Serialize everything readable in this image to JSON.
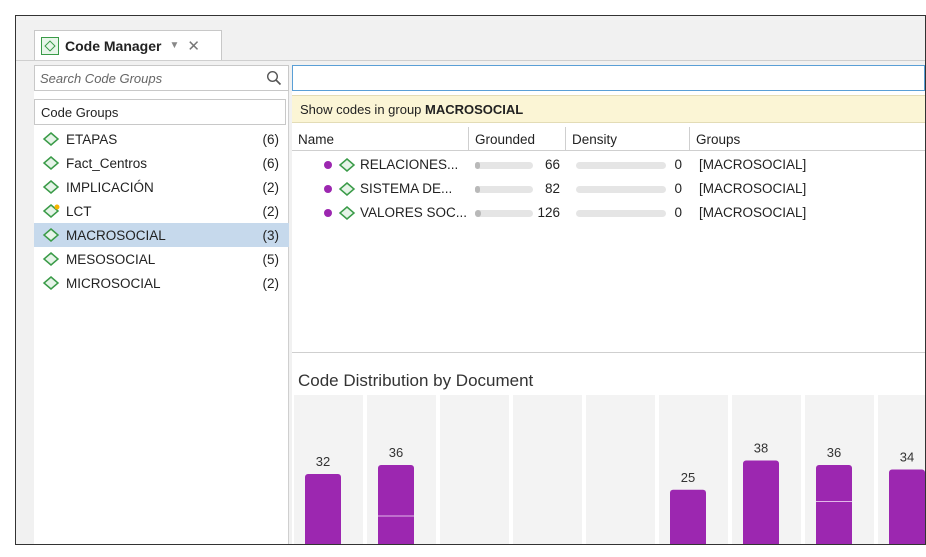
{
  "tab": {
    "title": "Code Manager",
    "dropdown": "▼",
    "close": "✕"
  },
  "search": {
    "placeholder": "Search Code Groups"
  },
  "groups_header": "Code Groups",
  "groups": [
    {
      "label": "ETAPAS",
      "count": "(6)",
      "selected": false,
      "star": false
    },
    {
      "label": "Fact_Centros",
      "count": "(6)",
      "selected": false,
      "star": false
    },
    {
      "label": "IMPLICACIÓN",
      "count": "(2)",
      "selected": false,
      "star": false
    },
    {
      "label": "LCT",
      "count": "(2)",
      "selected": false,
      "star": true
    },
    {
      "label": "MACROSOCIAL",
      "count": "(3)",
      "selected": true,
      "star": false
    },
    {
      "label": "MESOSOCIAL",
      "count": "(5)",
      "selected": false,
      "star": false
    },
    {
      "label": "MICROSOCIAL",
      "count": "(2)",
      "selected": false,
      "star": false
    }
  ],
  "banner": {
    "prefix": "Show codes in group ",
    "group": "MACROSOCIAL"
  },
  "columns": [
    "Name",
    "Grounded",
    "Density",
    "Groups"
  ],
  "codes": [
    {
      "name": "RELACIONES...",
      "grounded": "66",
      "grounded_fraction": 0.05,
      "density": "0",
      "groups": "[MACROSOCIAL]"
    },
    {
      "name": "SISTEMA DE...",
      "grounded": "82",
      "grounded_fraction": 0.07,
      "density": "0",
      "groups": "[MACROSOCIAL]"
    },
    {
      "name": "VALORES SOC...",
      "grounded": "126",
      "grounded_fraction": 0.11,
      "density": "0",
      "groups": "[MACROSOCIAL]"
    }
  ],
  "chart_title": "Code Distribution by Document",
  "colors": {
    "accent": "#9c27b0",
    "selection": "#c6d9ec",
    "banner": "#fbf5d5",
    "icon_green": "#3a9b48"
  },
  "chart_data": {
    "type": "bar",
    "columns": 9,
    "bars": [
      {
        "column": 0,
        "value": 32,
        "label": "32",
        "split": null
      },
      {
        "column": 1,
        "value": 36,
        "label": "36",
        "split": 0.63
      },
      {
        "column": 5,
        "value": 25,
        "label": "25",
        "split": null
      },
      {
        "column": 6,
        "value": 38,
        "label": "38",
        "split": null
      },
      {
        "column": 7,
        "value": 36,
        "label": "36",
        "split": 0.45
      },
      {
        "column": 8,
        "value": 34,
        "label": "34",
        "split": null
      }
    ],
    "ylim": [
      0,
      40
    ]
  }
}
